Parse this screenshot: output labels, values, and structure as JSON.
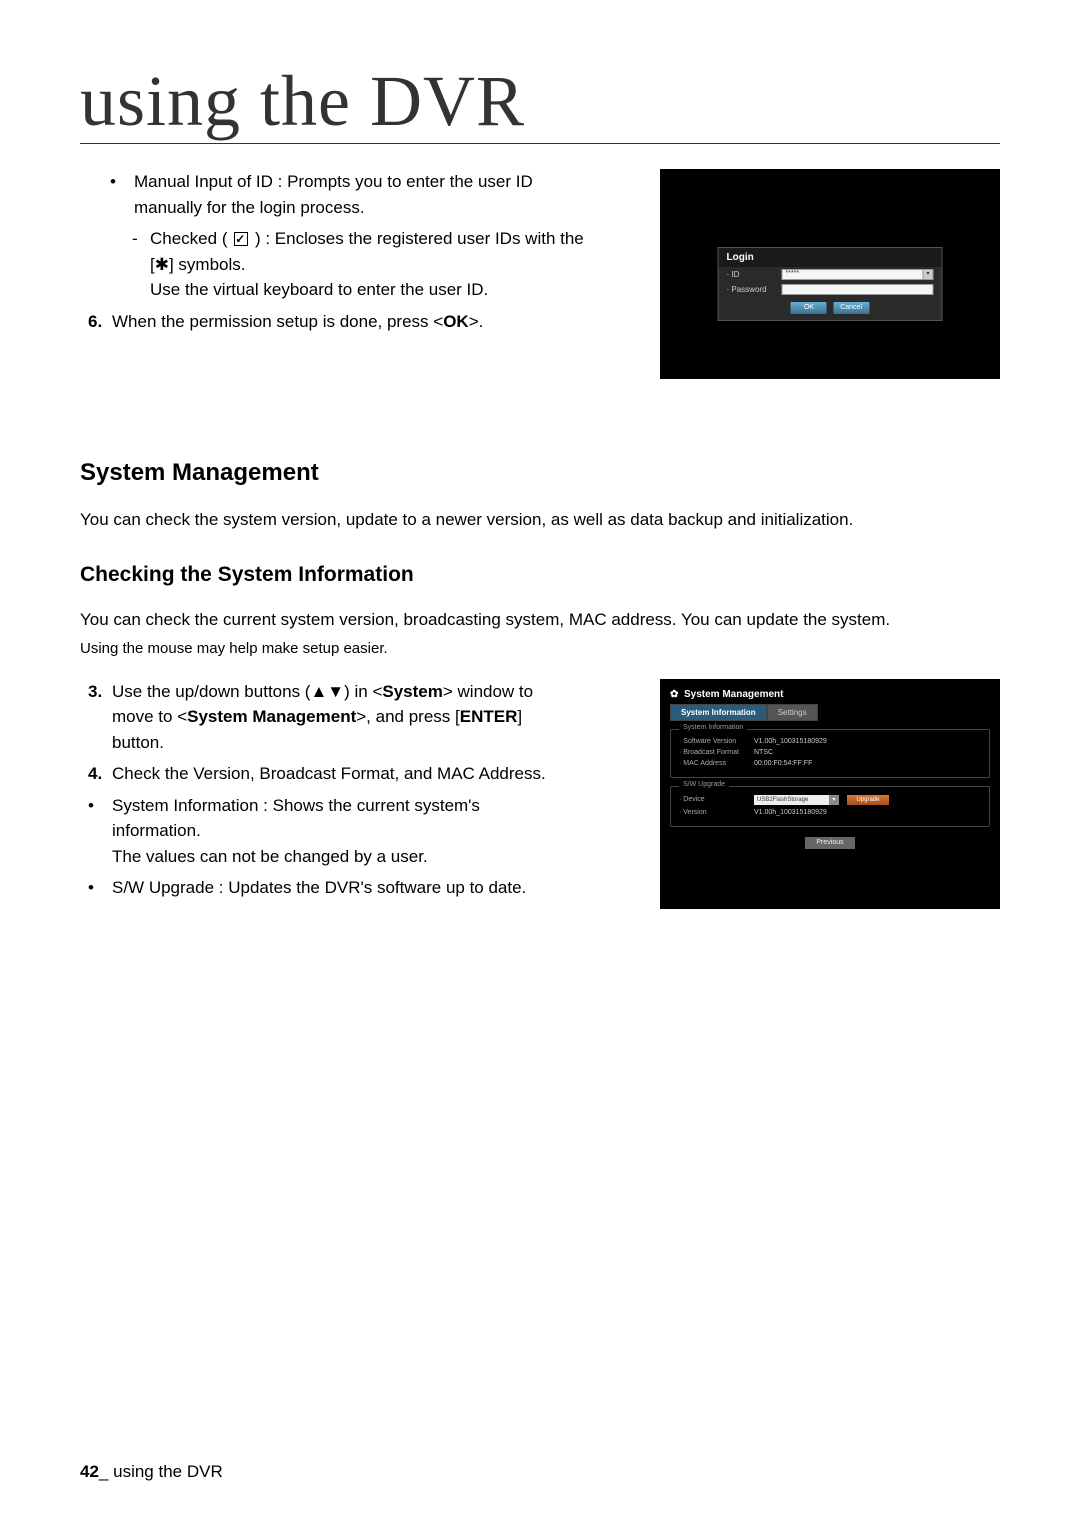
{
  "pageTitle": "using the DVR",
  "top": {
    "bullet1_line1": "Manual Input of ID : Prompts you to enter the user ID",
    "bullet1_line2": "manually for the login process.",
    "sub_checked_pre": "Checked (",
    "sub_checked_post": ") : Encloses the registered user IDs with the",
    "sub_checked_line2": "[✱] symbols.",
    "sub_checked_line3": "Use the virtual keyboard to enter the user ID.",
    "step6_pre": "When the permission setup is done, press <",
    "step6_bold": "OK",
    "step6_post": ">."
  },
  "login": {
    "title": "Login",
    "id_label": "· ID",
    "id_value": "*****",
    "pw_label": "· Password",
    "ok": "OK",
    "cancel": "Cancel"
  },
  "sm": {
    "heading": "System Management",
    "intro": "You can check the system version, update to a newer version, as well as data backup and initialization.",
    "subheading": "Checking the System Information",
    "desc1": "You can check the current system version, broadcasting system, MAC address. You can update the system.",
    "desc2": "Using the mouse may help make setup easier.",
    "step3a": "Use the up/down buttons (▲▼) in <",
    "step3b": "System",
    "step3c": "> window to",
    "step3d": "move to <",
    "step3e": "System Management",
    "step3f": ">, and press [",
    "step3g": "ENTER",
    "step3h": "]",
    "step3i": "button.",
    "step4": "Check the Version, Broadcast Format, and MAC Address.",
    "b1a": "System Information : Shows the current system's",
    "b1b": "information.",
    "b1c": "The values can not be changed by a user.",
    "b2": "S/W Upgrade : Updates the DVR's software up to date."
  },
  "panel": {
    "title": "System Management",
    "tab1": "System Information",
    "tab2": "Settings",
    "legend1": "System Information",
    "sw_version_label": "· Software Version",
    "sw_version_value": "V1.00h_100315180929",
    "bcast_label": "· Broadcast Format",
    "bcast_value": "NTSC",
    "mac_label": "· MAC Address",
    "mac_value": "00:00:F0:54:FF:FF",
    "legend2": "S/W Upgrade",
    "device_label": "· Device",
    "device_value": "USB2FlashStorage",
    "upgrade": "Upgrade",
    "version_label": "· Version",
    "version_value": "V1.00h_100315180929",
    "previous": "Previous"
  },
  "footer": {
    "pageNum": "42",
    "sep": "_ ",
    "text": "using the DVR"
  }
}
